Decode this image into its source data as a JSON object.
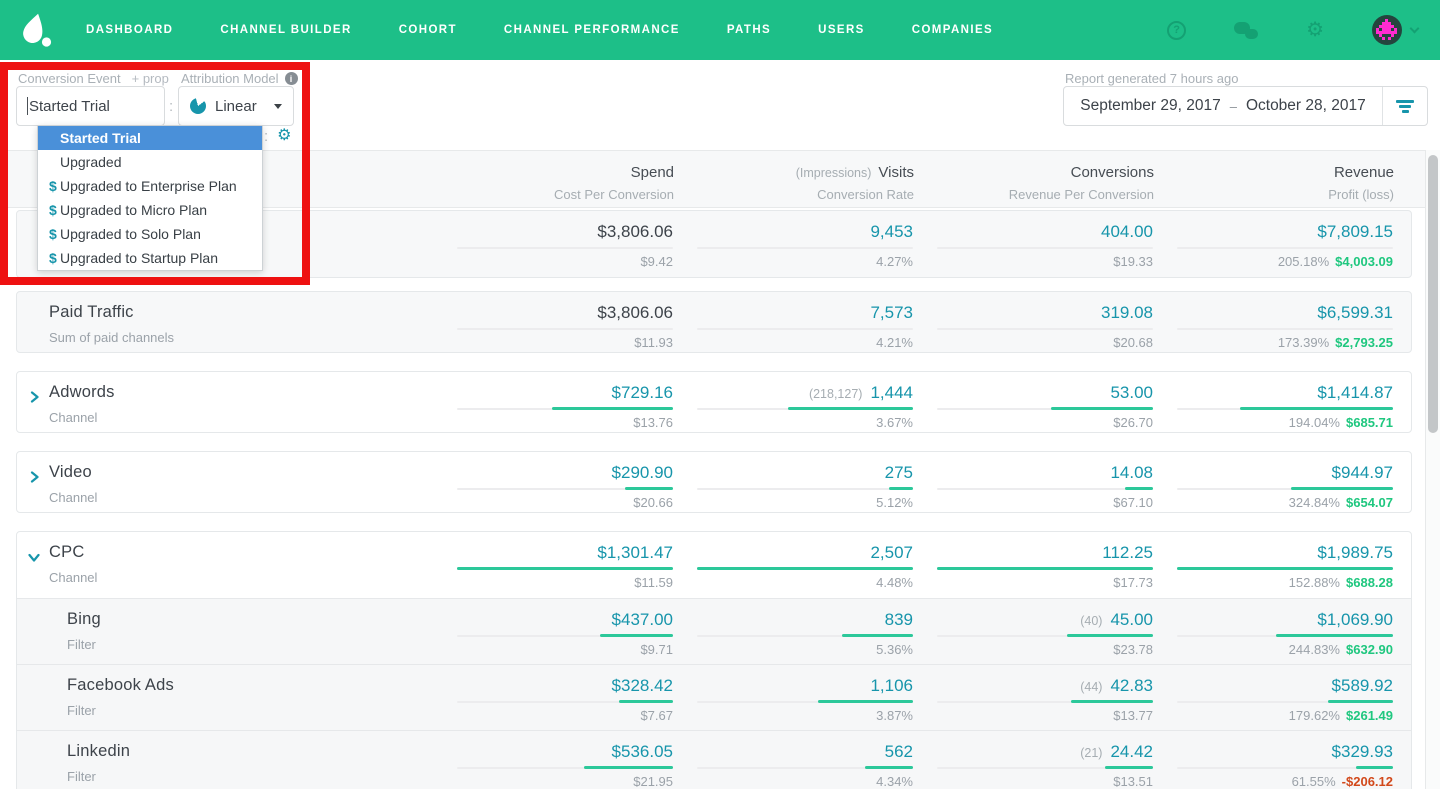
{
  "colors": {
    "nav-green": "#1dbf88",
    "nav-icon": "#14a173",
    "teal": "#1795ab",
    "bar-green": "#2cc89a",
    "profit-green": "#1fc77f",
    "neg-red": "#d2491b",
    "sel-blue": "#4a90d9",
    "annotation-red": "#ee1111",
    "text-dark": "#3d434a",
    "text-gray": "#9ba2a9",
    "label-gray": "#a9b0b6"
  },
  "nav": {
    "items": [
      "DASHBOARD",
      "CHANNEL BUILDER",
      "COHORT",
      "CHANNEL PERFORMANCE",
      "PATHS",
      "USERS",
      "COMPANIES"
    ]
  },
  "controls": {
    "conversion_label": "Conversion Event",
    "prop_label": "+ prop",
    "conversion_value": "Started Trial",
    "separator": ":",
    "attribution_label": "Attribution Model",
    "attribution_value": "Linear",
    "report_note": "Report generated 7 hours ago",
    "date_start": "September 29, 2017",
    "date_sep": "–",
    "date_end": "October 28, 2017"
  },
  "conversion_dropdown": {
    "items": [
      {
        "label": "Started Trial",
        "dollar": false,
        "selected": true
      },
      {
        "label": "Upgraded",
        "dollar": false,
        "selected": false
      },
      {
        "label": "Upgraded to Enterprise Plan",
        "dollar": true,
        "selected": false
      },
      {
        "label": "Upgraded to Micro Plan",
        "dollar": true,
        "selected": false
      },
      {
        "label": "Upgraded to Solo Plan",
        "dollar": true,
        "selected": false
      },
      {
        "label": "Upgraded to Startup Plan",
        "dollar": true,
        "selected": false
      }
    ]
  },
  "table": {
    "headers": [
      {
        "prefix": "",
        "title": "Spend",
        "sub": "Cost Per Conversion"
      },
      {
        "prefix": "(Impressions)",
        "title": "Visits",
        "sub": "Conversion Rate"
      },
      {
        "prefix": "",
        "title": "Conversions",
        "sub": "Revenue Per Conversion"
      },
      {
        "prefix": "",
        "title": "Revenue",
        "sub": "Profit (loss)"
      }
    ],
    "cards": [
      {
        "kind": "summary",
        "rows": [
          {
            "title": "",
            "subtitle": "",
            "chevron": null,
            "tall": true,
            "metrics": [
              {
                "value": "$3,806.06",
                "dark": true,
                "bar": 0,
                "sub": "$9.42"
              },
              {
                "value": "9,453",
                "bar": 0,
                "sub": "4.27%"
              },
              {
                "value": "404.00",
                "bar": 0,
                "sub": "$19.33"
              },
              {
                "value": "$7,809.15",
                "bar": 0,
                "sub": "205.18%",
                "profit": "$4,003.09",
                "neg": false
              }
            ]
          }
        ]
      },
      {
        "kind": "summary",
        "rows": [
          {
            "title": "Paid Traffic",
            "subtitle": "Sum of paid channels",
            "chevron": null,
            "metrics": [
              {
                "value": "$3,806.06",
                "dark": true,
                "bar": 0,
                "sub": "$11.93"
              },
              {
                "value": "7,573",
                "bar": 0,
                "sub": "4.21%"
              },
              {
                "value": "319.08",
                "bar": 0,
                "sub": "$20.68"
              },
              {
                "value": "$6,599.31",
                "bar": 0,
                "sub": "173.39%",
                "profit": "$2,793.25",
                "neg": false
              }
            ]
          }
        ]
      },
      {
        "kind": "channel",
        "rows": [
          {
            "title": "Adwords",
            "subtitle": "Channel",
            "chevron": "right",
            "metrics": [
              {
                "value": "$729.16",
                "bar": 0.56,
                "sub": "$13.76"
              },
              {
                "prefix": "(218,127)",
                "value": "1,444",
                "bar": 0.58,
                "sub": "3.67%"
              },
              {
                "value": "53.00",
                "bar": 0.47,
                "sub": "$26.70"
              },
              {
                "value": "$1,414.87",
                "bar": 0.71,
                "sub": "194.04%",
                "profit": "$685.71",
                "neg": false
              }
            ]
          }
        ]
      },
      {
        "kind": "channel",
        "rows": [
          {
            "title": "Video",
            "subtitle": "Channel",
            "chevron": "right",
            "metrics": [
              {
                "value": "$290.90",
                "bar": 0.22,
                "sub": "$20.66"
              },
              {
                "value": "275",
                "bar": 0.11,
                "sub": "5.12%"
              },
              {
                "value": "14.08",
                "bar": 0.13,
                "sub": "$67.10"
              },
              {
                "value": "$944.97",
                "bar": 0.47,
                "sub": "324.84%",
                "profit": "$654.07",
                "neg": false
              }
            ]
          }
        ]
      },
      {
        "kind": "channel",
        "rows": [
          {
            "title": "CPC",
            "subtitle": "Channel",
            "chevron": "down",
            "tall": true,
            "metrics": [
              {
                "value": "$1,301.47",
                "bar": 1,
                "sub": "$11.59"
              },
              {
                "value": "2,507",
                "bar": 1,
                "sub": "4.48%"
              },
              {
                "value": "112.25",
                "bar": 1,
                "sub": "$17.73"
              },
              {
                "value": "$1,989.75",
                "bar": 1,
                "sub": "152.88%",
                "profit": "$688.28",
                "neg": false
              }
            ]
          },
          {
            "title": "Bing",
            "subtitle": "Filter",
            "chevron": null,
            "filter": true,
            "tall": true,
            "metrics": [
              {
                "value": "$437.00",
                "bar": 0.34,
                "sub": "$9.71"
              },
              {
                "value": "839",
                "bar": 0.33,
                "sub": "5.36%"
              },
              {
                "prefix": "(40)",
                "value": "45.00",
                "bar": 0.4,
                "sub": "$23.78"
              },
              {
                "value": "$1,069.90",
                "bar": 0.54,
                "sub": "244.83%",
                "profit": "$632.90",
                "neg": false
              }
            ]
          },
          {
            "title": "Facebook Ads",
            "subtitle": "Filter",
            "chevron": null,
            "filter": true,
            "tall": true,
            "metrics": [
              {
                "value": "$328.42",
                "bar": 0.25,
                "sub": "$7.67"
              },
              {
                "value": "1,106",
                "bar": 0.44,
                "sub": "3.87%"
              },
              {
                "prefix": "(44)",
                "value": "42.83",
                "bar": 0.38,
                "sub": "$13.77"
              },
              {
                "value": "$589.92",
                "bar": 0.3,
                "sub": "179.62%",
                "profit": "$261.49",
                "neg": false
              }
            ]
          },
          {
            "title": "Linkedin",
            "subtitle": "Filter",
            "chevron": null,
            "filter": true,
            "tall": true,
            "metrics": [
              {
                "value": "$536.05",
                "bar": 0.41,
                "sub": "$21.95"
              },
              {
                "value": "562",
                "bar": 0.22,
                "sub": "4.34%"
              },
              {
                "prefix": "(21)",
                "value": "24.42",
                "bar": 0.22,
                "sub": "$13.51"
              },
              {
                "value": "$329.93",
                "bar": 0.17,
                "sub": "61.55%",
                "profit": "-$206.12",
                "neg": true
              }
            ]
          }
        ]
      }
    ]
  }
}
